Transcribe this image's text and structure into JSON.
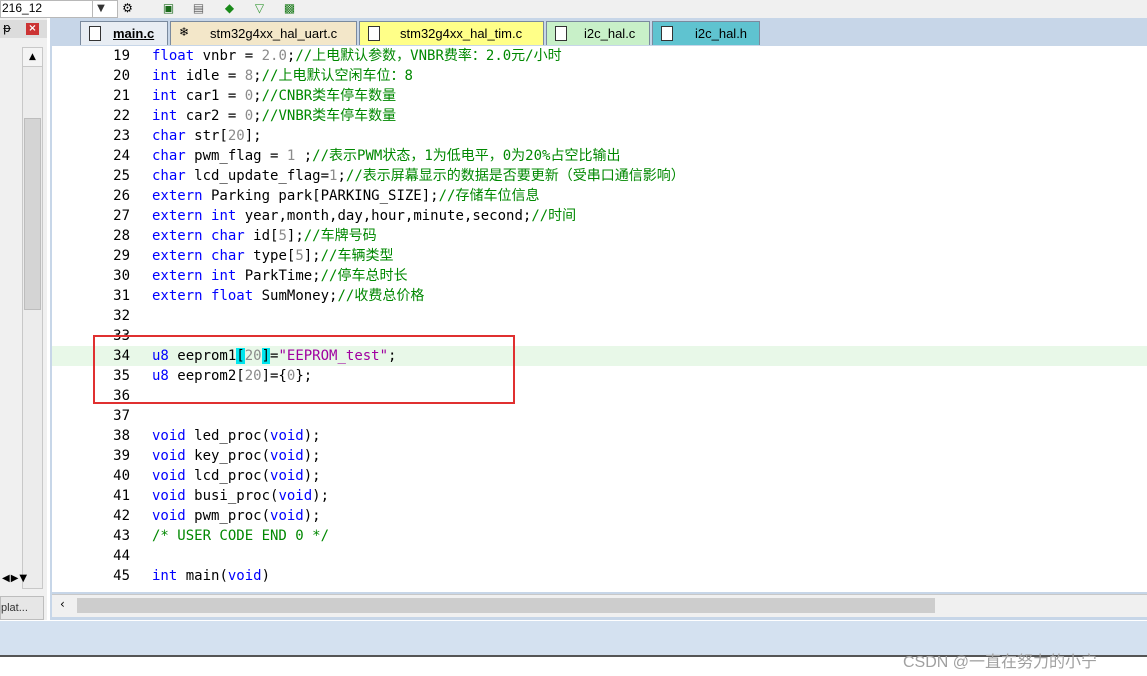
{
  "toolbar": {
    "combo_value": "216_12",
    "combo_dropdown_icon": "chevron-down-icon"
  },
  "left_panel": {
    "pin_icon": "pin-icon",
    "close_icon": "close-icon",
    "tab_label": "plat..."
  },
  "tabs": [
    {
      "label": "main.c",
      "active": true,
      "bg": "#e8edf3"
    },
    {
      "label": "stm32g4xx_hal_uart.c",
      "active": false,
      "bg": "#f3e7c9"
    },
    {
      "label": "stm32g4xx_hal_tim.c",
      "active": false,
      "bg": "#ffff88"
    },
    {
      "label": "i2c_hal.c",
      "active": false,
      "bg": "#c8f0c8"
    },
    {
      "label": "i2c_hal.h",
      "active": false,
      "bg": "#5fc3d0"
    }
  ],
  "code_lines": [
    {
      "n": "19",
      "code": "float vnbr = 2.0;//上电默认参数，VNBR费率：2.0元/小时"
    },
    {
      "n": "20",
      "code": "int idle = 8;//上电默认空闲车位：8"
    },
    {
      "n": "21",
      "code": "int car1 = 0;//CNBR类车停车数量"
    },
    {
      "n": "22",
      "code": "int car2 = 0;//VNBR类车停车数量"
    },
    {
      "n": "23",
      "code": "char str[20];"
    },
    {
      "n": "24",
      "code": "char pwm_flag = 1 ;//表示PWM状态，1为低电平，0为20%占空比输出"
    },
    {
      "n": "25",
      "code": "char lcd_update_flag=1;//表示屏幕显示的数据是否要更新（受串口通信影响）"
    },
    {
      "n": "26",
      "code": "extern Parking park[PARKING_SIZE];//存储车位信息"
    },
    {
      "n": "27",
      "code": "extern int year,month,day,hour,minute,second;//时间"
    },
    {
      "n": "28",
      "code": "extern char id[5];//车牌号码"
    },
    {
      "n": "29",
      "code": "extern char type[5];//车辆类型"
    },
    {
      "n": "30",
      "code": "extern int ParkTime;//停车总时长"
    },
    {
      "n": "31",
      "code": "extern float SumMoney;//收费总价格"
    },
    {
      "n": "32",
      "code": ""
    },
    {
      "n": "33",
      "code": ""
    },
    {
      "n": "34",
      "code": "u8 eeprom1[20]=\"EEPROM_test\";"
    },
    {
      "n": "35",
      "code": "u8 eeprom2[20]={0};"
    },
    {
      "n": "36",
      "code": ""
    },
    {
      "n": "37",
      "code": ""
    },
    {
      "n": "38",
      "code": "void led_proc(void);"
    },
    {
      "n": "39",
      "code": "void key_proc(void);"
    },
    {
      "n": "40",
      "code": "void lcd_proc(void);"
    },
    {
      "n": "41",
      "code": "void busi_proc(void);"
    },
    {
      "n": "42",
      "code": "void pwm_proc(void);"
    },
    {
      "n": "43",
      "code": "/* USER CODE END 0 */"
    },
    {
      "n": "44",
      "code": ""
    },
    {
      "n": "45",
      "code": "int main(void)"
    }
  ],
  "watermark": "CSDN @一直在努力的小宁",
  "colors": {
    "keyword": "#0000ff",
    "comment": "#008800",
    "number": "#8b8b8b",
    "string": "#a000a0",
    "current_line": "#e8f8e8",
    "bracket_match": "#00e5ee",
    "annotation_box": "#e03030"
  }
}
